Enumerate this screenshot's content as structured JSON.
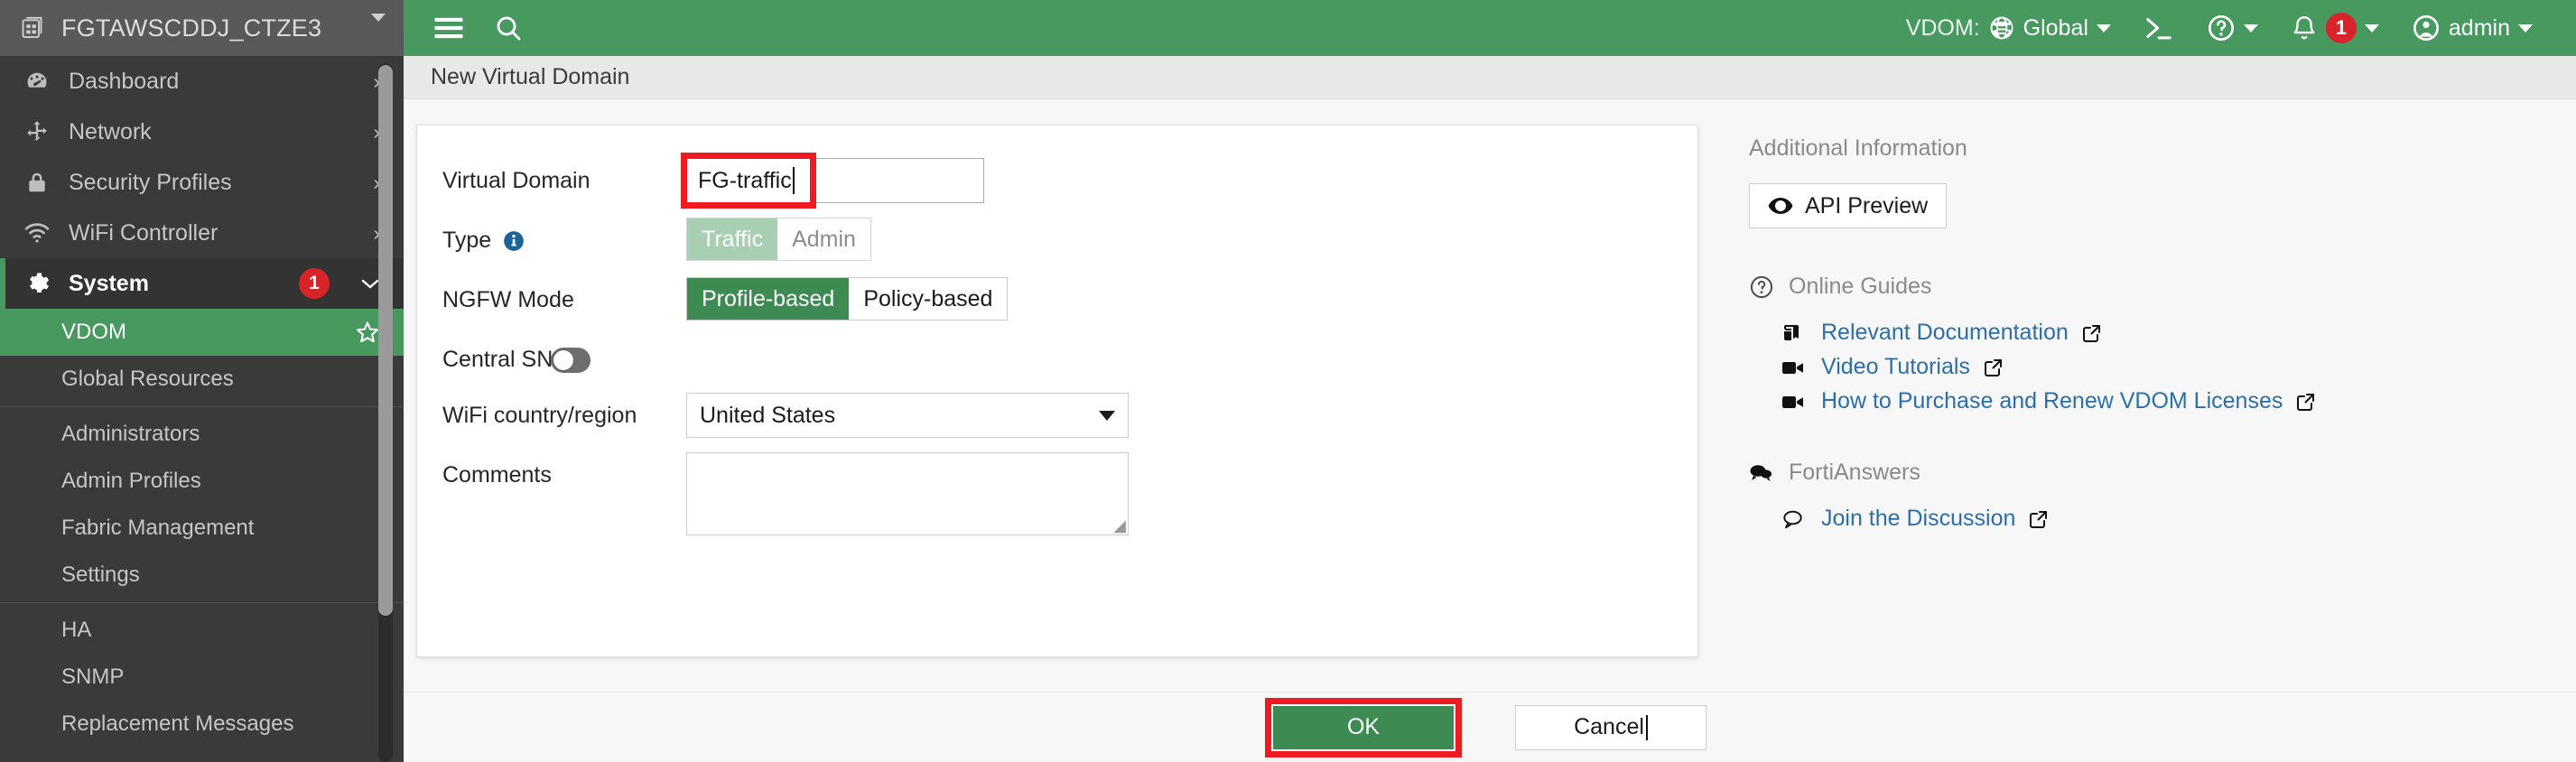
{
  "topbar": {
    "device_icon": "device-stack-icon",
    "device_name": "FGTAWSCDDJ_CTZE3",
    "menu_icon": "hamburger-menu-icon",
    "search_icon": "search-icon",
    "vdom_label": "VDOM:",
    "vdom_value": "Global",
    "globe_icon": "globe-icon",
    "cli_icon": "cli-console-icon",
    "help_icon": "help-question-icon",
    "alert_icon": "bell-notification-icon",
    "alert_count": "1",
    "user_icon": "user-avatar-icon",
    "user_name": "admin"
  },
  "sidebar": {
    "items": [
      {
        "label": "Dashboard",
        "icon": "dashboard-gauge-icon",
        "chevron": "›"
      },
      {
        "label": "Network",
        "icon": "network-arrows-icon",
        "chevron": "›"
      },
      {
        "label": "Security Profiles",
        "icon": "lock-shield-icon",
        "chevron": "›"
      },
      {
        "label": "WiFi Controller",
        "icon": "wifi-icon",
        "chevron": "›"
      },
      {
        "label": "System",
        "icon": "gear-icon",
        "chevron": "⌄",
        "badge": "1"
      }
    ],
    "sub_items": [
      {
        "label": "VDOM",
        "selected": true,
        "star": "star-outline-icon"
      },
      {
        "label": "Global Resources",
        "selected": false
      },
      {
        "label": "Administrators",
        "selected": false
      },
      {
        "label": "Admin Profiles",
        "selected": false
      },
      {
        "label": "Fabric Management",
        "selected": false
      },
      {
        "label": "Settings",
        "selected": false
      },
      {
        "label": "HA",
        "selected": false
      },
      {
        "label": "SNMP",
        "selected": false
      },
      {
        "label": "Replacement Messages",
        "selected": false
      }
    ]
  },
  "main": {
    "page_title": "New Virtual Domain"
  },
  "form": {
    "virtual_domain": {
      "label": "Virtual Domain",
      "value": "FG-traffic",
      "placeholder": ""
    },
    "type": {
      "label": "Type",
      "info_icon": "info-circle-icon",
      "options": [
        "Traffic",
        "Admin"
      ],
      "selected": "Traffic"
    },
    "ngfw_mode": {
      "label": "NGFW Mode",
      "options": [
        "Profile-based",
        "Policy-based"
      ],
      "selected": "Profile-based"
    },
    "central_snat": {
      "label": "Central SNAT",
      "enabled": false
    },
    "wifi_country": {
      "label": "WiFi country/region",
      "value": "United States"
    },
    "comments": {
      "label": "Comments",
      "value": "",
      "placeholder": ""
    }
  },
  "info_panel": {
    "title": "Additional Information",
    "api_preview": {
      "label": "API Preview",
      "icon": "eye-icon"
    },
    "online_guides": {
      "label": "Online Guides",
      "icon": "help-circle-icon",
      "links": [
        {
          "label": "Relevant Documentation",
          "icon": "book-icon",
          "external_icon": "external-link-icon"
        },
        {
          "label": "Video Tutorials",
          "icon": "video-camera-icon",
          "external_icon": "external-link-icon"
        },
        {
          "label": "How to Purchase and Renew VDOM Licenses",
          "icon": "video-camera-icon",
          "external_icon": "external-link-icon"
        }
      ]
    },
    "fortianswers": {
      "label": "FortiAnswers",
      "icon": "chat-bubbles-icon",
      "links": [
        {
          "label": "Join the Discussion",
          "icon": "chat-bubble-icon",
          "external_icon": "external-link-icon"
        }
      ]
    }
  },
  "footer": {
    "ok_label": "OK",
    "cancel_label": "Cancel"
  },
  "colors": {
    "brand_green": "#489960",
    "button_green": "#3d8a53",
    "muted_green": "#a9cfb2",
    "annotation_red": "#ee1c22",
    "badge_red": "#d8232a",
    "link_blue": "#2c6fa8",
    "sidebar_dark": "#3a3a3a",
    "topbar_gray": "#595959"
  }
}
